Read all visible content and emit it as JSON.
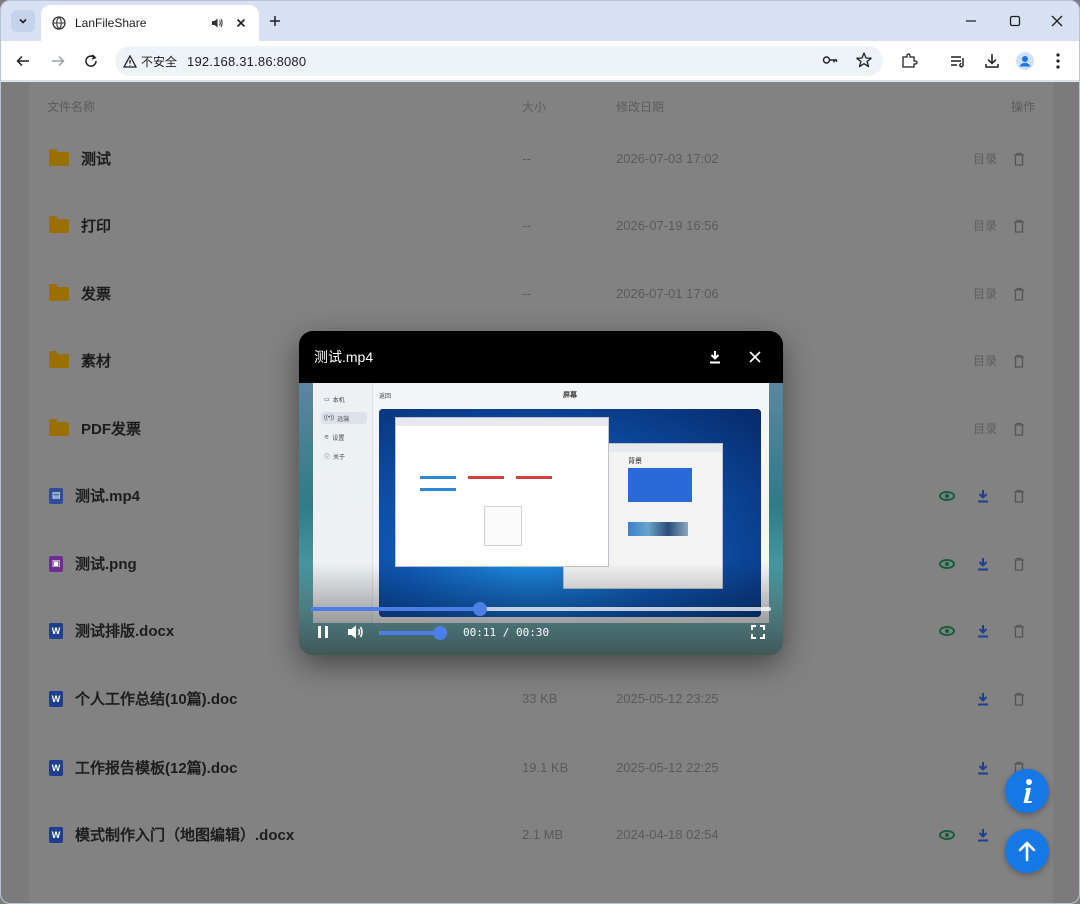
{
  "browser": {
    "tab_title": "LanFileShare",
    "security_label": "不安全",
    "url": "192.168.31.86:8080"
  },
  "columns": {
    "name": "文件名称",
    "size": "大小",
    "date": "修改日期",
    "actions": "操作"
  },
  "action_labels": {
    "dir": "目录"
  },
  "rows": [
    {
      "name": "测试",
      "type": "folder",
      "size": "--",
      "date": "2026-07-03 17:02"
    },
    {
      "name": "打印",
      "type": "folder",
      "size": "--",
      "date": "2026-07-19 16:56"
    },
    {
      "name": "发票",
      "type": "folder",
      "size": "--",
      "date": "2026-07-01 17:06"
    },
    {
      "name": "素材",
      "type": "folder",
      "size": "",
      "date": ""
    },
    {
      "name": "PDF发票",
      "type": "folder",
      "size": "",
      "date": ""
    },
    {
      "name": "测试.mp4",
      "type": "video",
      "size": "",
      "date": ""
    },
    {
      "name": "测试.png",
      "type": "image",
      "size": "",
      "date": ""
    },
    {
      "name": "测试排版.docx",
      "type": "word",
      "size": "",
      "date": ""
    },
    {
      "name": "个人工作总结(10篇).doc",
      "type": "word",
      "size": "33 KB",
      "date": "2025-05-12 23:25"
    },
    {
      "name": "工作报告模板(12篇).doc",
      "type": "word",
      "size": "19.1 KB",
      "date": "2025-05-12 22:25"
    },
    {
      "name": "模式制作入门（地图编辑）.docx",
      "type": "word",
      "size": "2.1 MB",
      "date": "2024-04-18 02:54"
    }
  ],
  "player": {
    "title": "测试.mp4",
    "current_time": "00:11",
    "separator": "/",
    "duration": "00:30",
    "progress": 0.367,
    "volume": 0.9
  },
  "video_frame": {
    "sidebar_items": [
      "本机",
      "远端",
      "设置",
      "关于"
    ],
    "back_label": "返回",
    "header_label": "屏幕",
    "bg_panel_title": "背景"
  },
  "colors": {
    "accent": "#1677e6",
    "folder": "#9a7000",
    "eye": "#145f3a",
    "word": "#1e3f8f",
    "image": "#6a2f8f",
    "video_file": "#2d4f9a"
  }
}
